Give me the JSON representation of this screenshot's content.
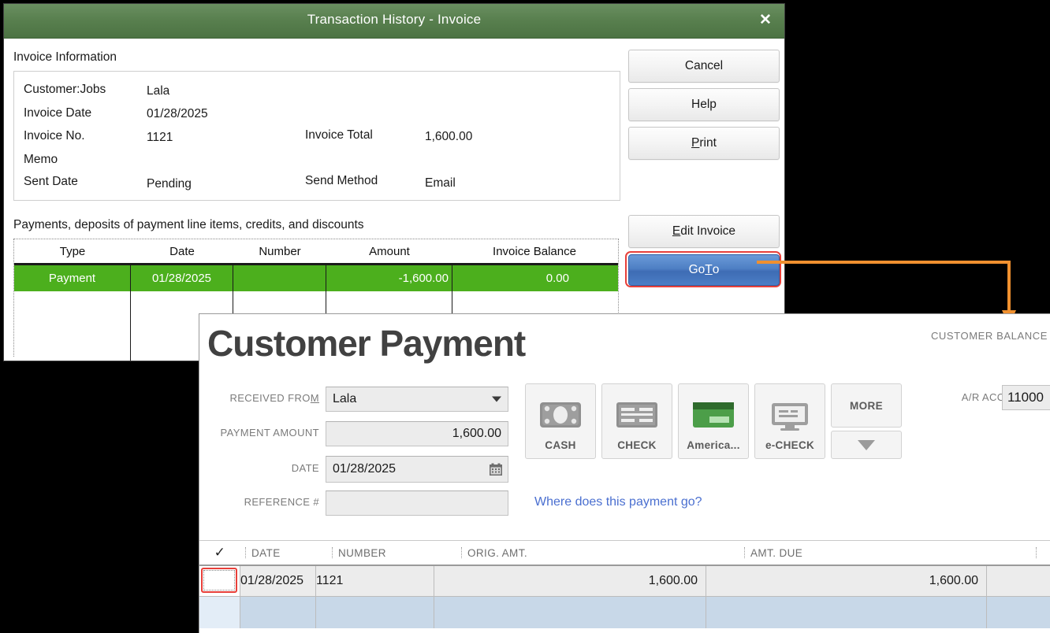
{
  "transaction_history": {
    "title": "Transaction History - Invoice",
    "close_icon": "close-icon",
    "invoice_information_label": "Invoice Information",
    "fields": {
      "customer_jobs_label": "Customer:Jobs",
      "customer_jobs_value": "Lala",
      "invoice_date_label": "Invoice Date",
      "invoice_date_value": "01/28/2025",
      "invoice_no_label": "Invoice No.",
      "invoice_no_value": "1121",
      "invoice_total_label": "Invoice Total",
      "invoice_total_value": "1,600.00",
      "memo_label": "Memo",
      "memo_value": "",
      "sent_date_label": "Sent Date",
      "sent_date_value": "Pending",
      "send_method_label": "Send Method",
      "send_method_value": "Email"
    },
    "buttons": {
      "cancel": "Cancel",
      "help": "Help",
      "print_pre": "",
      "print_key": "P",
      "print_post": "rint",
      "edit_invoice_key": "E",
      "edit_invoice_post": "dit Invoice",
      "goto_pre": "Go ",
      "goto_key": "T",
      "goto_post": "o"
    },
    "payments_section_label": "Payments, deposits of payment line items, credits, and discounts",
    "payments_table": {
      "columns": [
        "Type",
        "Date",
        "Number",
        "Amount",
        "Invoice Balance"
      ],
      "rows": [
        {
          "type": "Payment",
          "date": "01/28/2025",
          "number": "",
          "amount": "-1,600.00",
          "invoice_balance": "0.00",
          "selected": true
        },
        {
          "type": "",
          "date": "",
          "number": "",
          "amount": "",
          "invoice_balance": "",
          "selected": false
        }
      ]
    },
    "colors": {
      "titlebar_green": "#59804f",
      "selected_row_green": "#4caf1d",
      "goto_blue": "#4e7fc4",
      "highlight_red": "#e8403a"
    }
  },
  "annotation": {
    "arrow_color": "#f0902f",
    "arrow_name": "callout-arrow"
  },
  "customer_payment": {
    "title": "Customer Payment",
    "customer_balance_label": "CUSTOMER BALANCE",
    "form": {
      "received_from_label": "RECEIVED FRO",
      "received_from_key": "M",
      "received_from_value": "Lala",
      "payment_amount_label": "PAYMENT AMOUNT",
      "payment_amount_value": "1,600.00",
      "date_label": "DATE",
      "date_value": "01/28/2025",
      "reference_label": "REFERENCE #",
      "reference_value": "",
      "calendar_icon": "calendar-icon",
      "dropdown_icon": "chevron-down-icon"
    },
    "payment_methods": [
      {
        "label": "CASH",
        "icon": "cash-icon"
      },
      {
        "label": "CHECK",
        "icon": "check-icon"
      },
      {
        "label": "America...",
        "icon": "credit-card-icon"
      },
      {
        "label": "e-CHECK",
        "icon": "monitor-icon"
      }
    ],
    "more_label": "MORE",
    "more_dropdown_icon": "triangle-down-icon",
    "where_link": "Where does this payment go?",
    "ar_account_label": "A/R ACCOUNT",
    "ar_account_value": "11000",
    "grid": {
      "columns": [
        "✓",
        "DATE",
        "NUMBER",
        "ORIG. AMT.",
        "AMT. DUE"
      ],
      "rows": [
        {
          "checked": "",
          "date": "01/28/2025",
          "number": "1121",
          "orig_amt": "1,600.00",
          "amt_due": "1,600.00"
        },
        {
          "checked": "",
          "date": "",
          "number": "",
          "orig_amt": "",
          "amt_due": ""
        }
      ]
    }
  }
}
